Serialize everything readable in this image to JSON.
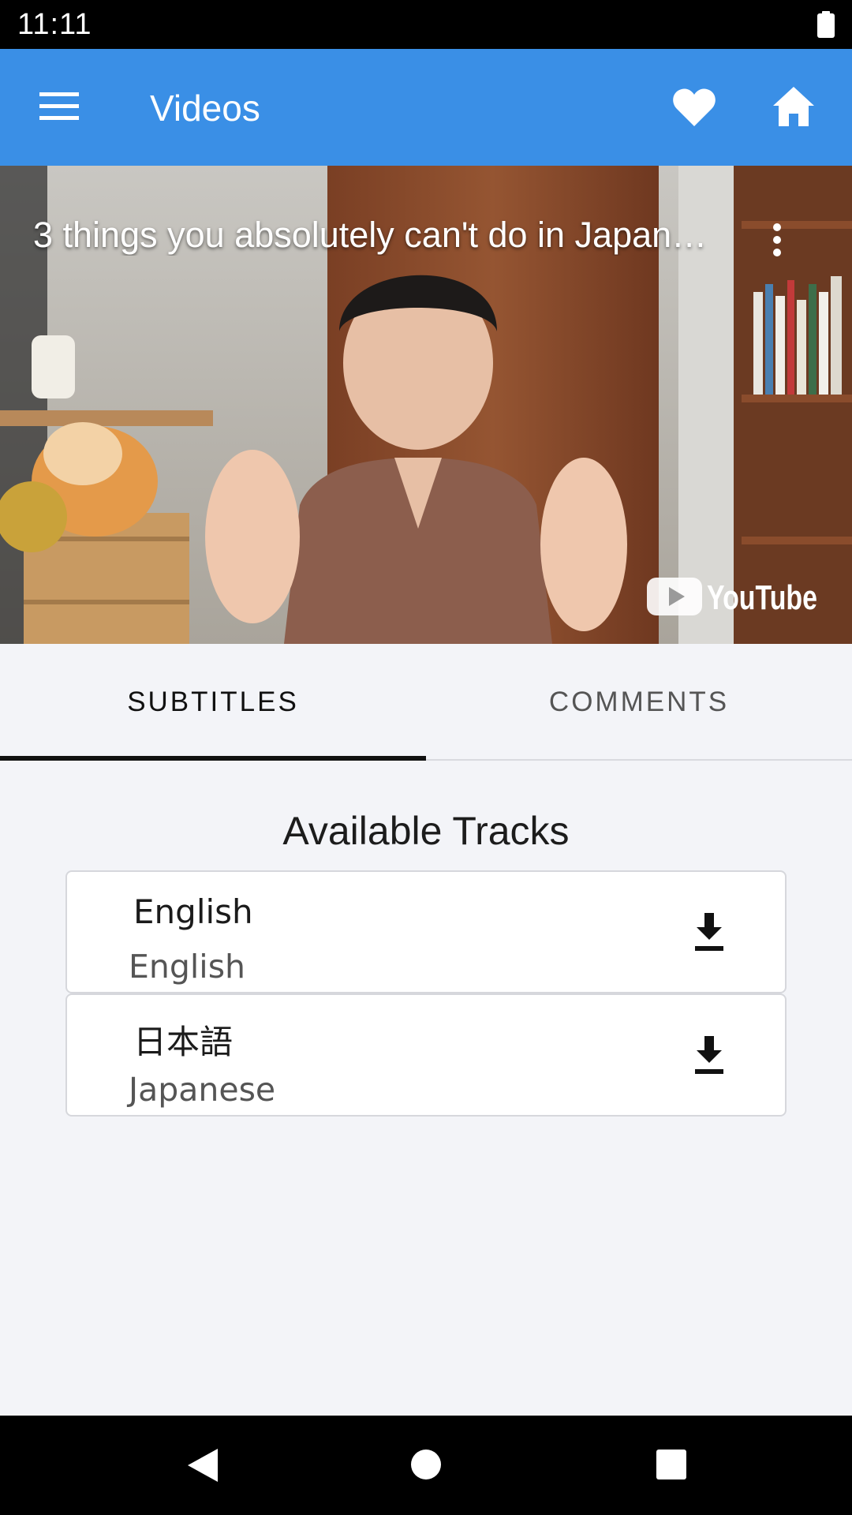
{
  "status_bar": {
    "time": "11:11",
    "battery_icon": "battery-full-icon"
  },
  "app_bar": {
    "title": "Videos",
    "menu_icon": "hamburger-menu-icon",
    "favorite_icon": "heart-icon",
    "home_icon": "home-icon",
    "color": "#3a8fe6"
  },
  "video": {
    "title": "3 things you absolutely can't do in Japan…",
    "more_icon": "vertical-dots-icon",
    "platform_logo": "YouTube"
  },
  "tabs": [
    {
      "label": "SUBTITLES",
      "selected": true
    },
    {
      "label": "COMMENTS",
      "selected": false
    }
  ],
  "subtitles": {
    "heading": "Available Tracks",
    "tracks": [
      {
        "native_name": "English",
        "english_name": "English",
        "action_icon": "download-icon"
      },
      {
        "native_name": "日本語",
        "english_name": "Japanese",
        "action_icon": "download-icon"
      }
    ]
  },
  "nav_bar": {
    "back_icon": "back-triangle-icon",
    "home_icon": "home-circle-icon",
    "recents_icon": "recents-square-icon"
  }
}
